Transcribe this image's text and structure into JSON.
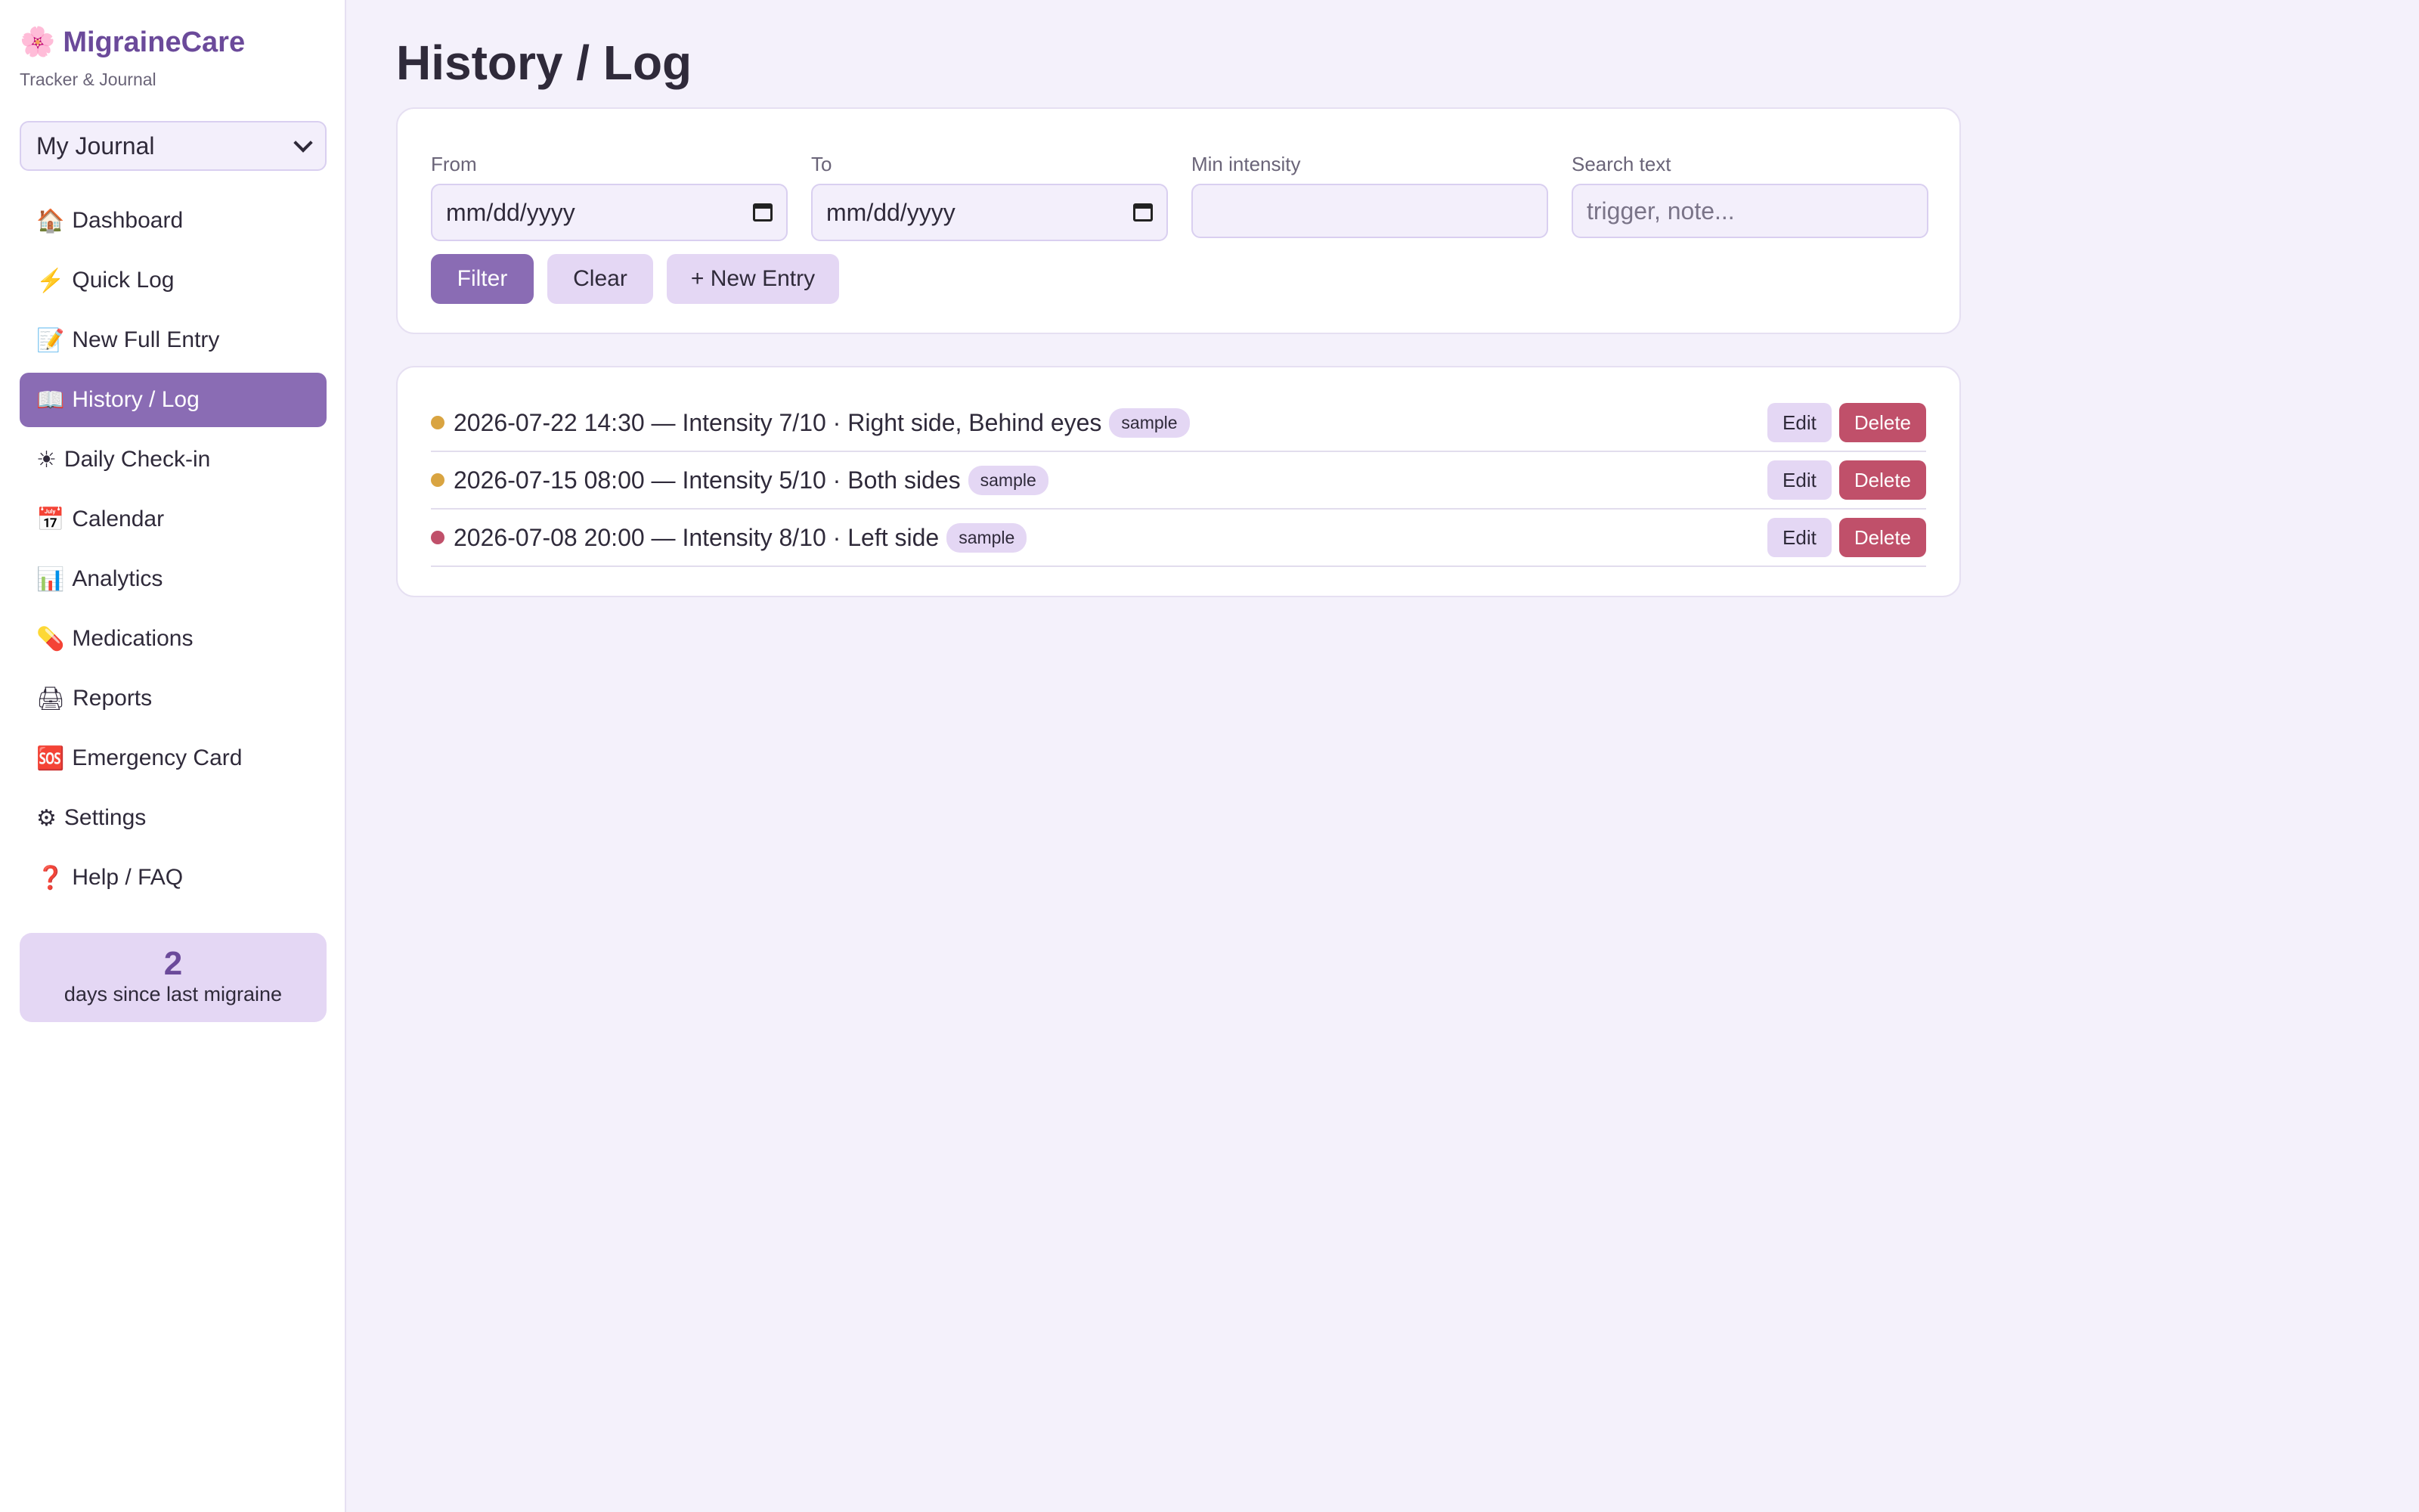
{
  "brand": {
    "logo_icon": "flower-icon",
    "logo_glyph": "🌸",
    "name": "MigraineCare",
    "tagline": "Tracker & Journal"
  },
  "journal_select": {
    "selected": "My Journal"
  },
  "nav": {
    "items": [
      {
        "icon": "🏠",
        "icon_name": "house-icon",
        "label": "Dashboard"
      },
      {
        "icon": "⚡",
        "icon_name": "lightning-icon",
        "label": "Quick Log"
      },
      {
        "icon": "📝",
        "icon_name": "memo-icon",
        "label": "New Full Entry"
      },
      {
        "icon": "📖",
        "icon_name": "book-icon",
        "label": "History / Log",
        "active": true
      },
      {
        "icon": "☀",
        "icon_name": "sun-icon",
        "label": "Daily Check-in"
      },
      {
        "icon": "📅",
        "icon_name": "calendar-icon",
        "label": "Calendar"
      },
      {
        "icon": "📊",
        "icon_name": "bar-chart-icon",
        "label": "Analytics"
      },
      {
        "icon": "💊",
        "icon_name": "pill-icon",
        "label": "Medications"
      },
      {
        "icon": "🖨",
        "icon_name": "printer-icon",
        "label": "Reports"
      },
      {
        "icon": "🆘",
        "icon_name": "sos-icon",
        "label": "Emergency Card"
      },
      {
        "icon": "⚙",
        "icon_name": "gear-icon",
        "label": "Settings"
      },
      {
        "icon": "❓",
        "icon_name": "question-icon",
        "label": "Help / FAQ"
      }
    ]
  },
  "streak": {
    "count": "2",
    "label": "days since last migraine"
  },
  "page": {
    "title": "History / Log"
  },
  "filters": {
    "from": {
      "label": "From",
      "placeholder": "mm/dd/yyyy"
    },
    "to": {
      "label": "To",
      "placeholder": "mm/dd/yyyy"
    },
    "min_intensity": {
      "label": "Min intensity",
      "value": ""
    },
    "search": {
      "label": "Search text",
      "placeholder": "trigger, note..."
    },
    "filter_button": "Filter",
    "clear_button": "Clear",
    "new_entry_button": "+ New Entry"
  },
  "entries": [
    {
      "text": "2026-07-22 14:30 — Intensity 7/10 · Right side, Behind eyes",
      "tag": "sample",
      "dot_color": "#d9a441",
      "edit": "Edit",
      "delete": "Delete"
    },
    {
      "text": "2026-07-15 08:00 — Intensity 5/10 · Both sides",
      "tag": "sample",
      "dot_color": "#d9a441",
      "edit": "Edit",
      "delete": "Delete"
    },
    {
      "text": "2026-07-08 20:00 — Intensity 8/10 · Left side",
      "tag": "sample",
      "dot_color": "#c0506a",
      "edit": "Edit",
      "delete": "Delete"
    }
  ],
  "colors": {
    "accent": "#8a6cb4",
    "accent_soft": "#e4d7f4",
    "danger": "#c0506a",
    "background": "#f4f1fb"
  }
}
